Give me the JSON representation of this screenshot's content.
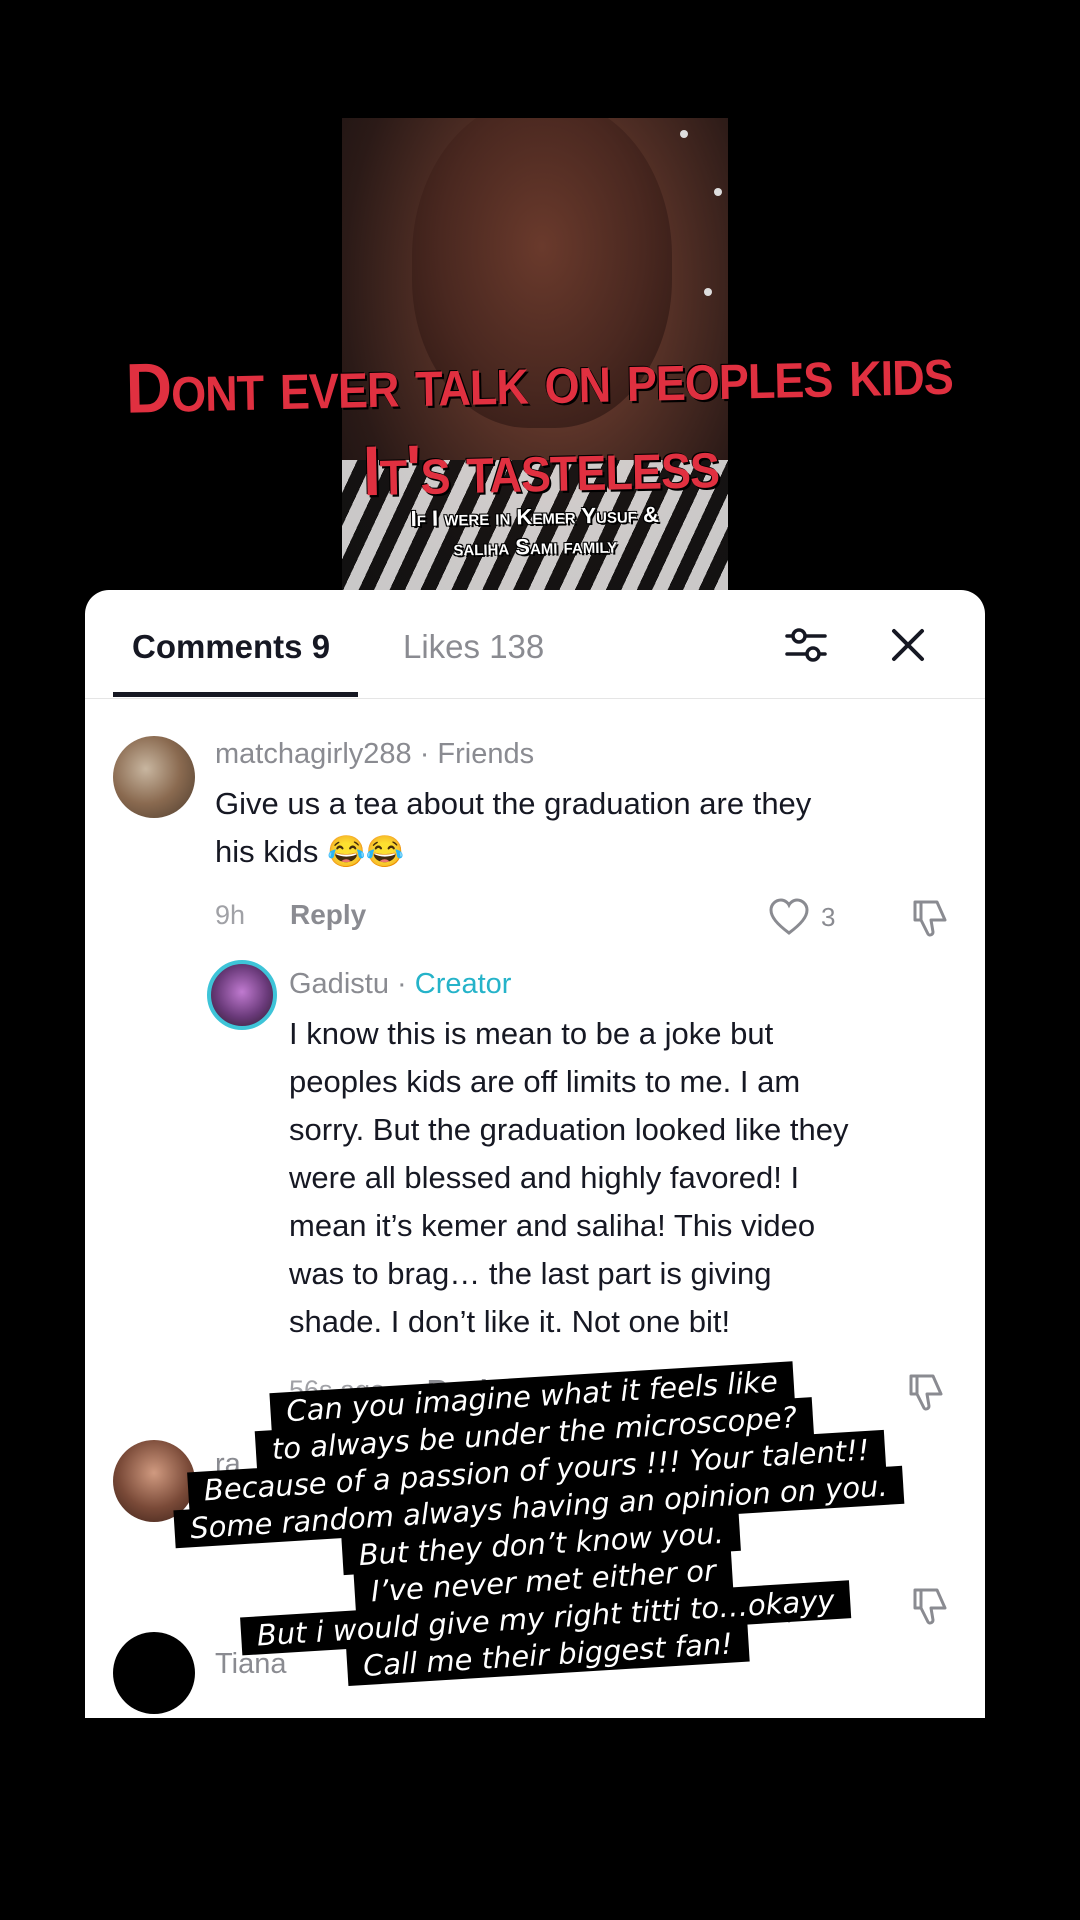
{
  "video": {
    "headline_line1": "Dont ever talk on peoples kids",
    "headline_line2": "It's tasteless",
    "subhead_line1": "If I were in Kemer Yusuf &",
    "subhead_line2": "saliha Sami family"
  },
  "tabs": {
    "comments_label": "Comments 9",
    "likes_label": "Likes 138"
  },
  "icons": {
    "filter": "filter-sliders-icon",
    "close": "close-icon",
    "like": "heart-icon",
    "dislike": "thumbs-down-icon"
  },
  "comments": [
    {
      "username": "matchagirly288",
      "badge": "· Friends",
      "text_line1": "Give us a tea about the graduation are they",
      "text_line2": "his kids 😂😂",
      "time": "9h",
      "reply": "Reply",
      "likes": "3"
    },
    {
      "username": "Gadistu",
      "separator": "·",
      "badge": "Creator",
      "lines": [
        "I know this is mean to be a joke but",
        "peoples kids are off limits to me. I am",
        "sorry. But the graduation looked like they",
        "were all blessed and highly favored! I",
        "mean it’s kemer and saliha! This video",
        "was to brag… the last part is giving",
        "shade. I don’t like it. Not one bit!"
      ],
      "time": "56s ago",
      "reply": "Reply"
    },
    {
      "username": "ra"
    },
    {
      "username": "Tiana"
    }
  ],
  "caption_lines": [
    "Can you imagine what it feels like",
    "to always be under the microscope?",
    "Because of a passion of yours !!! Your talent!!",
    "Some random always having an opinion on you.",
    "But they don’t know you.",
    "I’ve never met either or",
    "But i would give my right titti to…okayy",
    "Call me their biggest fan!"
  ],
  "colors": {
    "headline": "#e03040",
    "creator_badge": "#25b3c9",
    "avatar_ring": "#3ec4d8"
  }
}
